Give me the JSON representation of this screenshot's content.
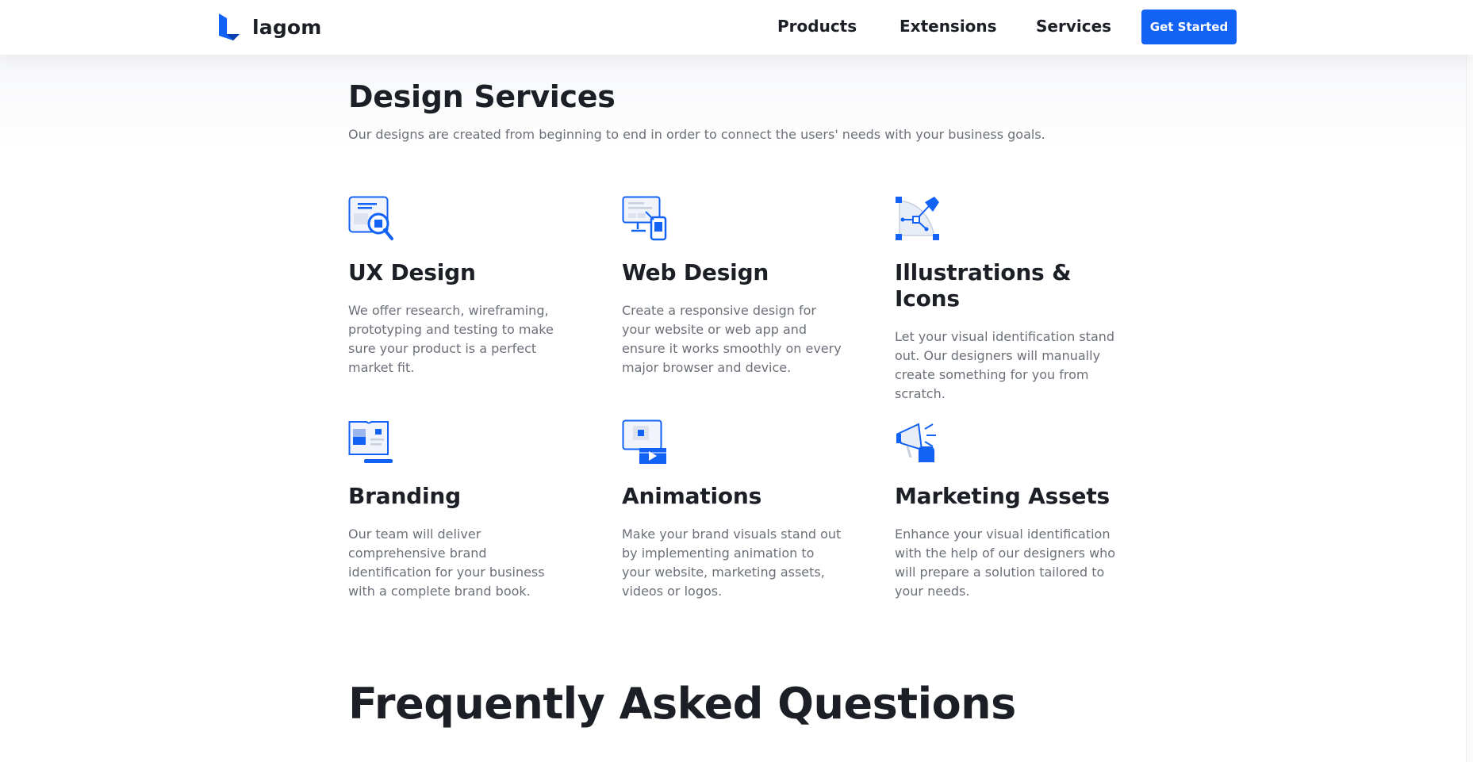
{
  "header": {
    "logo_text": "lagom",
    "nav": [
      "Products",
      "Extensions",
      "Services"
    ],
    "cta_label": "Get Started"
  },
  "services": {
    "title": "Design Services",
    "subtitle": "Our designs are created from beginning to end in order to connect the users' needs with your business goals.",
    "items": [
      {
        "icon": "ux-design-icon",
        "title": "UX Design",
        "description": "We offer research, wireframing, prototyping and testing to make sure your product is a perfect market fit."
      },
      {
        "icon": "web-design-icon",
        "title": "Web Design",
        "description": "Create a responsive design for your website or web app and ensure it works smoothly on every major browser and device."
      },
      {
        "icon": "illustrations-icon",
        "title": "Illustrations & Icons",
        "description": "Let your visual identification stand out. Our designers will manually create something for you from scratch."
      },
      {
        "icon": "branding-icon",
        "title": "Branding",
        "description": "Our team will deliver comprehensive brand identification for your business with a complete brand book."
      },
      {
        "icon": "animations-icon",
        "title": "Animations",
        "description": "Make your brand visuals stand out by implementing animation to your website, marketing assets, videos or logos."
      },
      {
        "icon": "marketing-assets-icon",
        "title": "Marketing Assets",
        "description": "Enhance your visual identification with the help of our designers who will prepare a solution tailored to your needs."
      }
    ]
  },
  "faq": {
    "title": "Frequently Asked Questions"
  },
  "colors": {
    "accent": "#1262f5",
    "text_dark": "#1c1f26",
    "text_muted": "#6b7078"
  }
}
